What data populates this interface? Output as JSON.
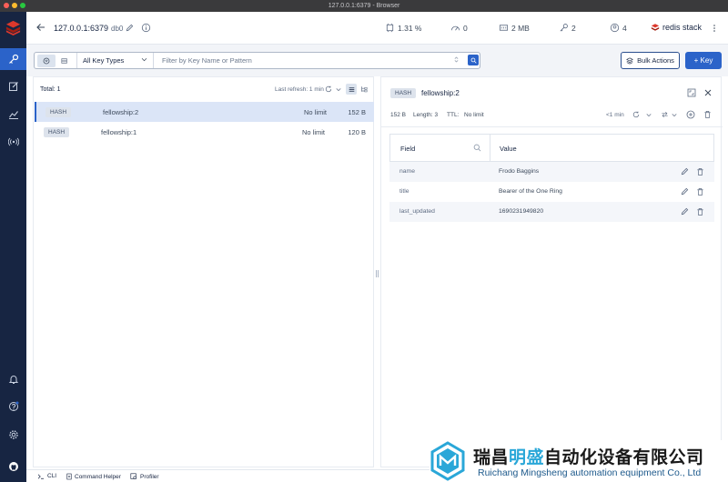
{
  "window": {
    "title": "127.0.0.1:6379 - Browser",
    "traffic_colors": [
      "#ff5f57",
      "#febc2e",
      "#28c840"
    ]
  },
  "colors": {
    "sidebar_bg": "#172542",
    "accent": "#2b63c9",
    "selected_row": "#dbe5f7",
    "brand_red": "#dc382c"
  },
  "sidebar": {
    "items": [
      {
        "icon": "key-icon",
        "active": true
      },
      {
        "icon": "edit-icon",
        "active": false
      },
      {
        "icon": "chart-icon",
        "active": false
      },
      {
        "icon": "broadcast-icon",
        "active": false
      }
    ],
    "bottom_items": [
      {
        "icon": "bell-icon"
      },
      {
        "icon": "help-icon"
      },
      {
        "icon": "gear-icon"
      },
      {
        "icon": "github-icon"
      }
    ]
  },
  "header": {
    "host": "127.0.0.1:6379",
    "db": "db0",
    "stats": {
      "cpu": "1.31 %",
      "ops": "0",
      "memory": "2 MB",
      "keys": "2",
      "clients": "4"
    },
    "brand": "redis stack"
  },
  "toolbar": {
    "key_type": "All Key Types",
    "search_placeholder": "Filter by Key Name or Pattern",
    "bulk_label": "Bulk Actions",
    "add_key_label": "+ Key"
  },
  "list": {
    "total": "Total: 1",
    "last_refresh": "Last refresh: 1 min",
    "rows": [
      {
        "type": "HASH",
        "name": "fellowship:2",
        "ttl": "No limit",
        "size": "152 B",
        "selected": true
      },
      {
        "type": "HASH",
        "name": "fellowship:1",
        "ttl": "No limit",
        "size": "120 B",
        "selected": false
      }
    ]
  },
  "detail": {
    "type": "HASH",
    "key": "fellowship:2",
    "size": "152 B",
    "length": "Length: 3",
    "ttl_label": "TTL:",
    "ttl_value": "No limit",
    "refresh": "<1 min",
    "columns": {
      "field": "Field",
      "value": "Value"
    },
    "rows": [
      {
        "field": "name",
        "value": "Frodo Baggins"
      },
      {
        "field": "title",
        "value": "Bearer of the One Ring"
      },
      {
        "field": "last_updated",
        "value": "1690231949820"
      }
    ]
  },
  "bottom_bar": {
    "cli": "CLI",
    "helper": "Command Helper",
    "profiler": "Profiler"
  },
  "watermark": {
    "cn_prefix": "瑞昌",
    "cn_highlight": "明盛",
    "cn_suffix": "自动化设备有限公司",
    "en": "Ruichang Mingsheng automation equipment Co., Ltd"
  }
}
